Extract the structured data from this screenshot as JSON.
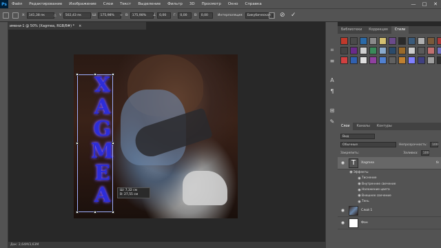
{
  "menu": {
    "logo": "Ps",
    "items": [
      "Файл",
      "Редактирование",
      "Изображение",
      "Слои",
      "Текст",
      "Выделение",
      "Фильтр",
      "3D",
      "Просмотр",
      "Окно",
      "Справка"
    ]
  },
  "window_controls": {
    "minimize": "—",
    "maximize": "□",
    "close": "✕"
  },
  "options": {
    "x_label": "X:",
    "x_value": "141,38 пк",
    "y_label": "Y:",
    "y_value": "502,43 пк",
    "w_label": "Ш:",
    "w_value": "175,98%",
    "h_label": "В:",
    "h_value": "175,98%",
    "angle_value": "0,00",
    "h_skew_label": "Г:",
    "h_skew_value": "0,00",
    "v_skew_label": "В:",
    "v_skew_value": "0,00",
    "interpolation_label": "Интерполяция:",
    "interpolation_value": "Бикубическая"
  },
  "document": {
    "tab_title": "имени-1 @ 50% (Xagmea, RGB/8#) *",
    "tab_close": "×",
    "graffiti_text": "XAGMEA",
    "status": "Док: 2,64M/3,63M"
  },
  "transform_tip": {
    "w": "Ш: 7,32 см",
    "h": "В: 27,55 см"
  },
  "styles_panel": {
    "tabs": [
      "Библиотеки",
      "Коррекция",
      "Стили"
    ],
    "active_tab": "Стили",
    "swatches": [
      "#c0392b",
      "#4a4a4a",
      "#2a6aa8",
      "#8a8a8a",
      "#d4c070",
      "#6a4a8a",
      "#2a2a2a",
      "#3a5a7a",
      "#b0b0b0",
      "#7a5a3a",
      "#aa3a3a",
      "#444444",
      "#6a2a8a",
      "#d0d0d0",
      "#3a8a5a",
      "#8aaacc",
      "#2a4a6a",
      "#9a6a2a",
      "#cccccc",
      "#5a5a5a",
      "#c07070",
      "#7070c0",
      "#d04040",
      "#3060b0",
      "#e0e0e0",
      "#9040a0",
      "#5080d0",
      "#606060",
      "#c08030",
      "#8080ff",
      "#404080",
      "#a0a0a0",
      "#303030"
    ]
  },
  "layers_panel": {
    "tabs": [
      "Слои",
      "Каналы",
      "Контуры"
    ],
    "active_tab": "Слои",
    "kind_value": "Вид",
    "blend_mode": "Обычные",
    "opacity_label": "Непрозрачность:",
    "opacity_value": "100",
    "lock_label": "Закрепить:",
    "fill_label": "Заливка:",
    "fill_value": "100",
    "text_layer_name": "Xagmea",
    "effects_label": "Эффекты",
    "effects": [
      "Тиснение",
      "Внутреннее свечение",
      "Наложение цвета",
      "Внешнее свечение",
      "Тень"
    ],
    "layer1_name": "Слой 1",
    "background_name": "Фон",
    "text_thumb_glyph": "T",
    "fx_badge": "fx"
  }
}
